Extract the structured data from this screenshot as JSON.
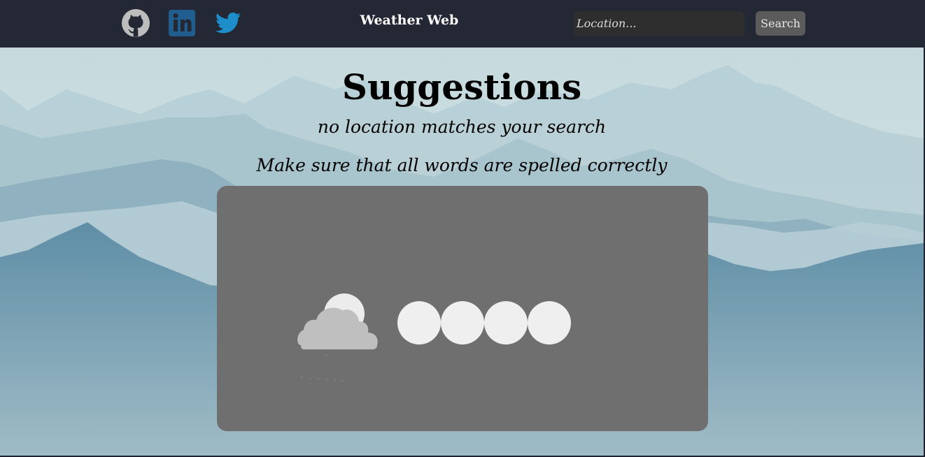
{
  "nav": {
    "brand": "Weather Web",
    "social": [
      {
        "name": "github",
        "icon": "github-icon"
      },
      {
        "name": "linkedin",
        "icon": "linkedin-icon"
      },
      {
        "name": "twitter",
        "icon": "twitter-icon"
      }
    ],
    "search": {
      "placeholder": "Location...",
      "value": "",
      "button_label": "Search"
    }
  },
  "main": {
    "title": "Suggestions",
    "message": "no location matches your search",
    "tip": "Make sure that all words are spelled correctly"
  },
  "card": {
    "icon": "cloud-sun-rain-icon",
    "loader": "loading-dots",
    "loader_dot_count": 4
  },
  "colors": {
    "navbar": "#232834",
    "card": "#6f6f6f",
    "linkedin": "#1f5e8e",
    "twitter": "#1d8ec9",
    "github": "#bdbdbd"
  }
}
